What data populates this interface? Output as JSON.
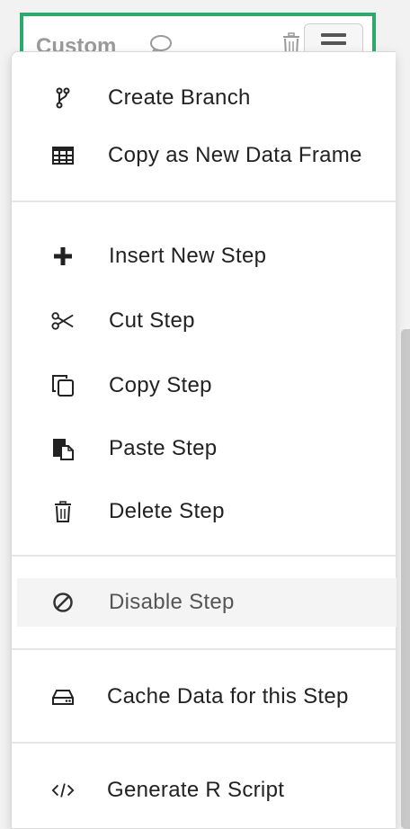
{
  "step_card": {
    "title": "Custom",
    "accent_color": "#2daa6b",
    "icons": [
      "comment-icon",
      "trash-icon",
      "menu-icon"
    ]
  },
  "menu": {
    "items": [
      {
        "label": "Create Branch",
        "icon": "branch-icon"
      },
      {
        "label": "Copy as New Data Frame",
        "icon": "table-icon"
      },
      {
        "label": "Insert New Step",
        "icon": "plus-icon"
      },
      {
        "label": "Cut Step",
        "icon": "scissors-icon"
      },
      {
        "label": "Copy Step",
        "icon": "copy-icon"
      },
      {
        "label": "Paste Step",
        "icon": "paste-icon"
      },
      {
        "label": "Delete Step",
        "icon": "trash-icon"
      },
      {
        "label": "Disable Step",
        "icon": "disable-icon",
        "highlighted": true
      },
      {
        "label": "Cache Data for this Step",
        "icon": "drive-icon"
      },
      {
        "label": "Generate R Script",
        "icon": "code-icon"
      }
    ]
  }
}
